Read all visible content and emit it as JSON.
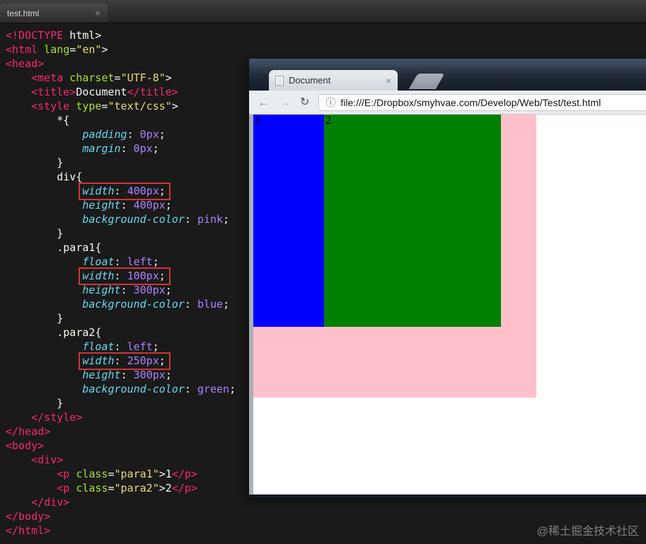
{
  "editor": {
    "tab_title": "test.html",
    "tab_close": "×",
    "code": [
      {
        "indent": 0,
        "tokens": [
          [
            "tag",
            "<!DOCTYPE"
          ],
          [
            "plain",
            " html>"
          ]
        ]
      },
      {
        "indent": 0,
        "tokens": [
          [
            "tag",
            "<html"
          ],
          [
            "attr",
            " lang"
          ],
          [
            "plain",
            "="
          ],
          [
            "str",
            "\"en\""
          ],
          [
            "plain",
            ">"
          ]
        ]
      },
      {
        "indent": 0,
        "tokens": [
          [
            "tag",
            "<head>"
          ]
        ]
      },
      {
        "indent": 1,
        "tokens": [
          [
            "tag",
            "<meta"
          ],
          [
            "attr",
            " charset"
          ],
          [
            "plain",
            "="
          ],
          [
            "str",
            "\"UTF-8\""
          ],
          [
            "plain",
            ">"
          ]
        ]
      },
      {
        "indent": 1,
        "tokens": [
          [
            "tag",
            "<title>"
          ],
          [
            "plain",
            "Document"
          ],
          [
            "tag",
            "</title>"
          ]
        ]
      },
      {
        "indent": 1,
        "tokens": [
          [
            "tag",
            "<style"
          ],
          [
            "attr",
            " type"
          ],
          [
            "plain",
            "="
          ],
          [
            "str",
            "\"text/css\""
          ],
          [
            "plain",
            ">"
          ]
        ]
      },
      {
        "indent": 2,
        "tokens": [
          [
            "plain",
            "*{"
          ]
        ]
      },
      {
        "indent": 3,
        "tokens": [
          [
            "prop",
            "padding"
          ],
          [
            "plain",
            ": "
          ],
          [
            "num",
            "0px"
          ],
          [
            "plain",
            ";"
          ]
        ]
      },
      {
        "indent": 3,
        "tokens": [
          [
            "prop",
            "margin"
          ],
          [
            "plain",
            ": "
          ],
          [
            "num",
            "0px"
          ],
          [
            "plain",
            ";"
          ]
        ]
      },
      {
        "indent": 2,
        "tokens": [
          [
            "plain",
            "}"
          ]
        ]
      },
      {
        "indent": 2,
        "tokens": [
          [
            "plain",
            "div{"
          ]
        ]
      },
      {
        "indent": 3,
        "boxed": true,
        "tokens": [
          [
            "prop",
            "width"
          ],
          [
            "plain",
            ": "
          ],
          [
            "num",
            "400px"
          ],
          [
            "plain",
            ";"
          ]
        ]
      },
      {
        "indent": 3,
        "tokens": [
          [
            "prop",
            "height"
          ],
          [
            "plain",
            ": "
          ],
          [
            "num",
            "400px"
          ],
          [
            "plain",
            ";"
          ]
        ]
      },
      {
        "indent": 3,
        "tokens": [
          [
            "prop",
            "background-color"
          ],
          [
            "plain",
            ": "
          ],
          [
            "num",
            "pink"
          ],
          [
            "plain",
            ";"
          ]
        ]
      },
      {
        "indent": 2,
        "tokens": [
          [
            "plain",
            "}"
          ]
        ]
      },
      {
        "indent": 2,
        "tokens": [
          [
            "plain",
            ".para1{"
          ]
        ]
      },
      {
        "indent": 3,
        "tokens": [
          [
            "prop",
            "float"
          ],
          [
            "plain",
            ": "
          ],
          [
            "num",
            "left"
          ],
          [
            "plain",
            ";"
          ]
        ]
      },
      {
        "indent": 3,
        "boxed": true,
        "tokens": [
          [
            "prop",
            "width"
          ],
          [
            "plain",
            ": "
          ],
          [
            "num",
            "100px"
          ],
          [
            "plain",
            ";"
          ]
        ]
      },
      {
        "indent": 3,
        "tokens": [
          [
            "prop",
            "height"
          ],
          [
            "plain",
            ": "
          ],
          [
            "num",
            "300px"
          ],
          [
            "plain",
            ";"
          ]
        ]
      },
      {
        "indent": 3,
        "tokens": [
          [
            "prop",
            "background-color"
          ],
          [
            "plain",
            ": "
          ],
          [
            "num",
            "blue"
          ],
          [
            "plain",
            ";"
          ]
        ]
      },
      {
        "indent": 2,
        "tokens": [
          [
            "plain",
            "}"
          ]
        ]
      },
      {
        "indent": 2,
        "tokens": [
          [
            "plain",
            ".para2{"
          ]
        ]
      },
      {
        "indent": 3,
        "tokens": [
          [
            "prop",
            "float"
          ],
          [
            "plain",
            ": "
          ],
          [
            "num",
            "left"
          ],
          [
            "plain",
            ";"
          ]
        ]
      },
      {
        "indent": 3,
        "boxed": true,
        "tokens": [
          [
            "prop",
            "width"
          ],
          [
            "plain",
            ": "
          ],
          [
            "num",
            "250px"
          ],
          [
            "plain",
            ";"
          ]
        ]
      },
      {
        "indent": 3,
        "tokens": [
          [
            "prop",
            "height"
          ],
          [
            "plain",
            ": "
          ],
          [
            "num",
            "300px"
          ],
          [
            "plain",
            ";"
          ]
        ]
      },
      {
        "indent": 3,
        "tokens": [
          [
            "prop",
            "background-color"
          ],
          [
            "plain",
            ": "
          ],
          [
            "num",
            "green"
          ],
          [
            "plain",
            ";"
          ]
        ]
      },
      {
        "indent": 2,
        "tokens": [
          [
            "plain",
            "}"
          ]
        ]
      },
      {
        "indent": 1,
        "tokens": [
          [
            "tag",
            "</style>"
          ]
        ]
      },
      {
        "indent": 0,
        "tokens": [
          [
            "tag",
            "</head>"
          ]
        ]
      },
      {
        "indent": 0,
        "tokens": [
          [
            "tag",
            "<body>"
          ]
        ]
      },
      {
        "indent": 1,
        "tokens": [
          [
            "tag",
            "<div>"
          ]
        ]
      },
      {
        "indent": 2,
        "tokens": [
          [
            "tag",
            "<p"
          ],
          [
            "attr",
            " class"
          ],
          [
            "plain",
            "="
          ],
          [
            "str",
            "\"para1\""
          ],
          [
            "plain",
            ">1"
          ],
          [
            "tag",
            "</p>"
          ]
        ]
      },
      {
        "indent": 2,
        "tokens": [
          [
            "tag",
            "<p"
          ],
          [
            "attr",
            " class"
          ],
          [
            "plain",
            "="
          ],
          [
            "str",
            "\"para2\""
          ],
          [
            "plain",
            ">2"
          ],
          [
            "tag",
            "</p>"
          ]
        ]
      },
      {
        "indent": 1,
        "tokens": [
          [
            "tag",
            "</div>"
          ]
        ]
      },
      {
        "indent": 0,
        "tokens": [
          [
            "tag",
            "</body>"
          ]
        ]
      },
      {
        "indent": 0,
        "tokens": [
          [
            "tag",
            "</html>"
          ]
        ]
      }
    ]
  },
  "browser": {
    "tab_title": "Document",
    "tab_close": "×",
    "url": "file:///E:/Dropbox/smyhvae.com/Develop/Web/Test/test.html",
    "nav": {
      "back": "←",
      "forward": "→",
      "reload": "↻",
      "info": "ⓘ"
    },
    "page": {
      "para1_text": "1",
      "para2_text": "2",
      "colors": {
        "container": "#ffc0cb",
        "para1": "#0000ff",
        "para2": "#008000"
      }
    }
  },
  "watermark": "@稀土掘金技术社区"
}
